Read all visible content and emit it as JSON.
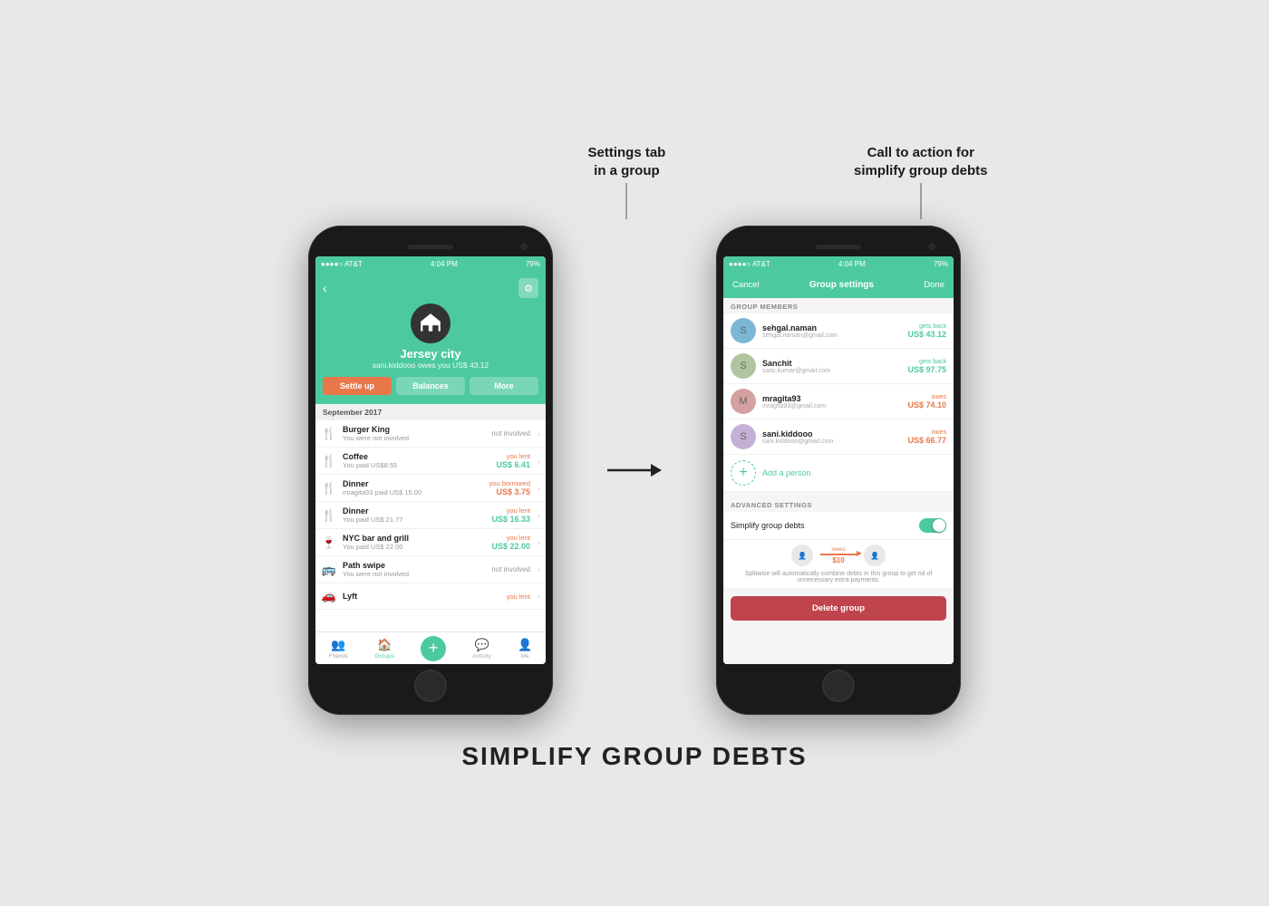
{
  "page": {
    "title": "SIMPLIFY GROUP DEBTS",
    "bg_color": "#e8e8e8"
  },
  "annotations": {
    "left": "Settings tab\nin a group",
    "right": "Call to action for\nsimplify group debts"
  },
  "phone_left": {
    "status_bar": {
      "carrier": "●●●●○ AT&T",
      "wifi": "▾",
      "time": "4:04 PM",
      "battery": "79%"
    },
    "header": {
      "group_name": "Jersey city",
      "subtitle": "sani.kiddooo owes you US$ 43.12",
      "btn_settle": "Settle up",
      "btn_balances": "Balances",
      "btn_more": "More"
    },
    "section_header": "September 2017",
    "items": [
      {
        "name": "Burger King",
        "sub": "You were not involved",
        "amount_label": "not involved",
        "amount_value": "not involved",
        "icon": "🍴"
      },
      {
        "name": "Coffee",
        "sub": "You paid US$8.55",
        "amount_label": "you lent",
        "amount_value": "US$ 6.41",
        "icon": "🍴"
      },
      {
        "name": "Dinner",
        "sub": "mragita93 paid US$ 15.00",
        "amount_label": "you borrowed",
        "amount_value": "US$ 3.75",
        "icon": "🍴"
      },
      {
        "name": "Dinner",
        "sub": "You paid US$ 21.77",
        "amount_label": "you lent",
        "amount_value": "US$ 16.33",
        "icon": "🍴"
      },
      {
        "name": "NYC bar and grill",
        "sub": "You paid US$ 22.00",
        "amount_label": "you lent",
        "amount_value": "US$ 22.00",
        "icon": "🍷"
      },
      {
        "name": "Path swipe",
        "sub": "You were not involved",
        "amount_label": "not involved",
        "amount_value": "not involved",
        "icon": "🚌"
      }
    ],
    "nav": {
      "items": [
        "Friends",
        "Groups",
        "",
        "Activity",
        "Me"
      ]
    }
  },
  "phone_right": {
    "status_bar": {
      "carrier": "●●●●○ AT&T",
      "wifi": "▾",
      "time": "4:04 PM",
      "battery": "79%"
    },
    "nav_bar": {
      "cancel": "Cancel",
      "title": "Group settings",
      "done": "Done"
    },
    "group_members_header": "GROUP MEMBERS",
    "members": [
      {
        "name": "sehgal.naman",
        "email": "sehgal.naman@gmail.com",
        "status": "gets back",
        "amount": "US$ 43.12",
        "color": "teal"
      },
      {
        "name": "Sanchit",
        "email": "sanc.kumar@gmail.com",
        "status": "gets back",
        "amount": "US$ 97.75",
        "color": "teal"
      },
      {
        "name": "mragita93",
        "email": "mragita93@gmail.com",
        "status": "owes",
        "amount": "US$ 74.10",
        "color": "orange"
      },
      {
        "name": "sani.kiddooo",
        "email": "sani.kiddooo@gmail.com",
        "status": "owes",
        "amount": "US$ 66.77",
        "color": "orange"
      }
    ],
    "add_person": "Add a person",
    "advanced_header": "ADVANCED SETTINGS",
    "simplify_label": "Simplify group debts",
    "simplify_desc": "Splitwise will automatically combine debts in this group to get rid of unnecessary extra payments.",
    "diagram": {
      "owes_label": "owes",
      "amount": "$10"
    },
    "delete_btn": "Delete group"
  }
}
